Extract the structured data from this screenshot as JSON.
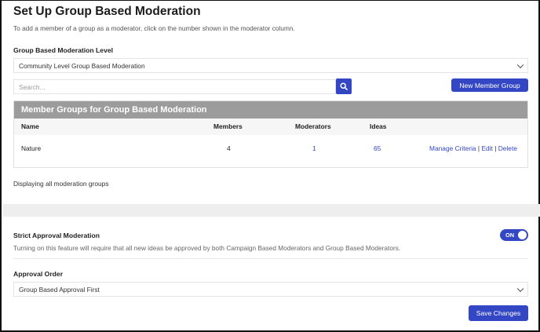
{
  "page": {
    "title": "Set Up Group Based Moderation",
    "subtitle": "To add a member of a group as a moderator, click on the number shown in the moderator column."
  },
  "moderation_level": {
    "label": "Group Based Moderation Level",
    "selected": "Community Level Group Based Moderation"
  },
  "search": {
    "placeholder": "Search...",
    "icon": "search-icon"
  },
  "new_group_button": "New Member Group",
  "groups_table": {
    "title": "Member Groups for Group Based Moderation",
    "columns": [
      "Name",
      "Members",
      "Moderators",
      "Ideas"
    ],
    "rows": [
      {
        "name": "Nature",
        "members": "4",
        "moderators": "1",
        "ideas": "65",
        "actions": [
          "Manage Criteria",
          "Edit",
          "Delete"
        ]
      }
    ]
  },
  "status_text": "Displaying all moderation groups",
  "strict_approval": {
    "label": "Strict Approval Moderation",
    "description": "Turning on this feature will require that all new ideas be approved by both Campaign Based Moderators and Group Based Moderators.",
    "toggle_label": "ON",
    "enabled": true
  },
  "approval_order": {
    "label": "Approval Order",
    "selected": "Group Based Approval First"
  },
  "save_button": "Save Changes",
  "colors": {
    "accent": "#3346c4",
    "table_header": "#9c9c9c"
  }
}
